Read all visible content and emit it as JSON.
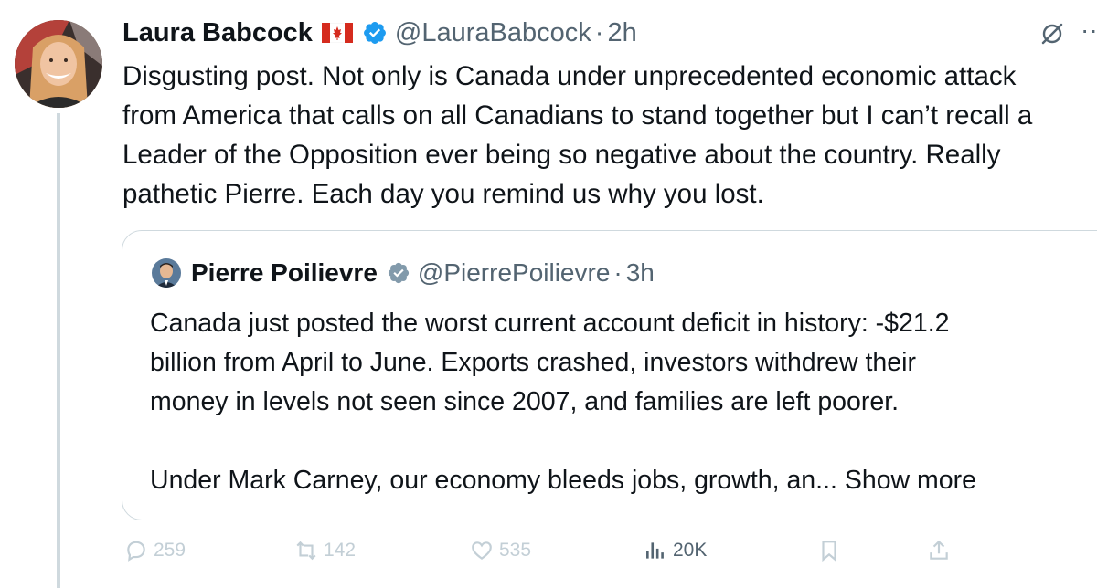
{
  "tweet": {
    "author_name": "Laura Babcock",
    "handle": "@LauraBabcock",
    "separator": "·",
    "time": "2h",
    "text": "Disgusting post. Not only is Canada under unprecedented economic attack\nfrom America that calls on all Canadians to stand together but I can’t recall a\nLeader of the Opposition ever being so negative about the country. Really\npathetic Pierre. Each day you remind us why you lost."
  },
  "quote": {
    "author_name": "Pierre Poilievre",
    "handle": "@PierrePoilievre",
    "separator": "·",
    "time": "3h",
    "text": "Canada just posted the worst current account deficit in history: -$21.2\nbillion from April to June. Exports crashed, investors withdrew their\nmoney in levels not seen since 2007, and families are left poorer.",
    "truncated_text": "Under Mark Carney, our economy bleeds jobs, growth, an...",
    "show_more": "Show more"
  },
  "actions": {
    "replies": "259",
    "reposts": "142",
    "likes": "535",
    "views": "20K"
  },
  "icons": {
    "verified": "verified-badge-icon",
    "flag": "canada-flag-icon",
    "grok": "grok-icon",
    "more": "more-icon"
  },
  "colors": {
    "verified_blue": "#1d9bf0",
    "verified_gray": "#829aab",
    "secondary_text": "#536471",
    "faded_action": "#c3cfd6"
  }
}
